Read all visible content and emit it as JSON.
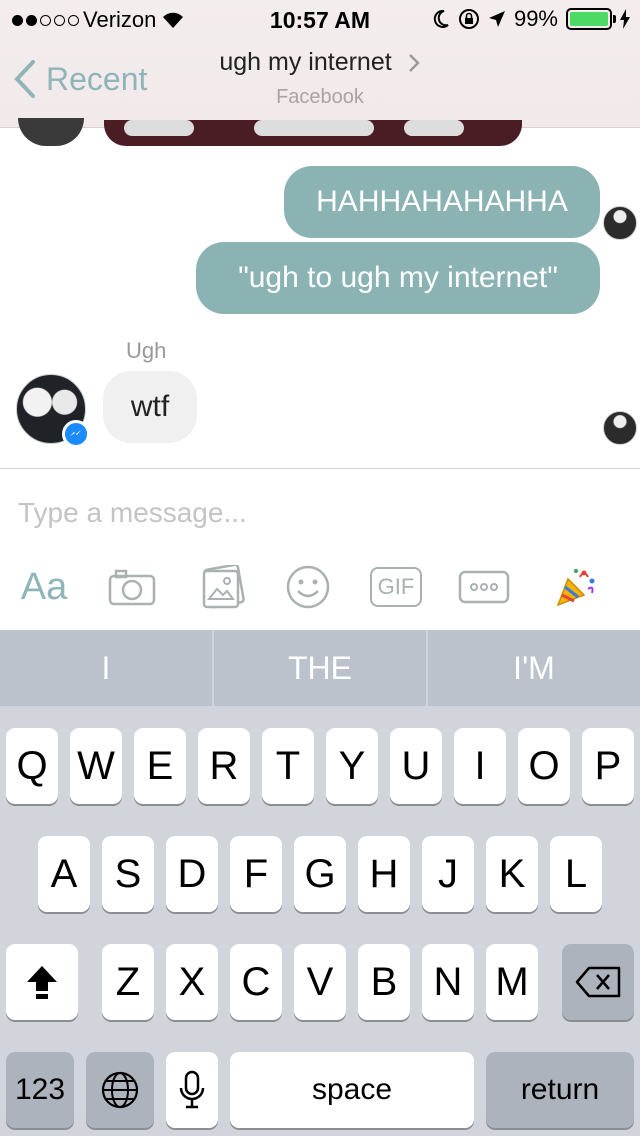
{
  "status_bar": {
    "carrier": "Verizon",
    "signal_dots": [
      true,
      true,
      false,
      false,
      false
    ],
    "time": "10:57 AM",
    "battery": "99%",
    "battery_level": 0.99
  },
  "nav": {
    "back_label": "Recent",
    "title": "ugh my internet",
    "subtitle": "Facebook"
  },
  "messages": {
    "outgoing": [
      "HAHHAHAHAHHA",
      "\"ugh to ugh my internet\""
    ],
    "incoming_sender": "Ugh",
    "incoming": [
      "wtf"
    ]
  },
  "composer": {
    "placeholder": "Type a message...",
    "aa_label": "Aa",
    "gif_label": "GIF"
  },
  "keyboard": {
    "predictions": [
      "I",
      "THE",
      "I'M"
    ],
    "row1": [
      "Q",
      "W",
      "E",
      "R",
      "T",
      "Y",
      "U",
      "I",
      "O",
      "P"
    ],
    "row2": [
      "A",
      "S",
      "D",
      "F",
      "G",
      "H",
      "J",
      "K",
      "L"
    ],
    "row3": [
      "Z",
      "X",
      "C",
      "V",
      "B",
      "N",
      "M"
    ],
    "numbers_label": "123",
    "space_label": "space",
    "return_label": "return"
  },
  "colors": {
    "accent": "#8fb5b9",
    "outgoing_bubble": "#8cb3b3",
    "incoming_bubble": "#f0f0f0",
    "messenger_blue": "#1a8cff",
    "battery_green": "#4cd964"
  }
}
